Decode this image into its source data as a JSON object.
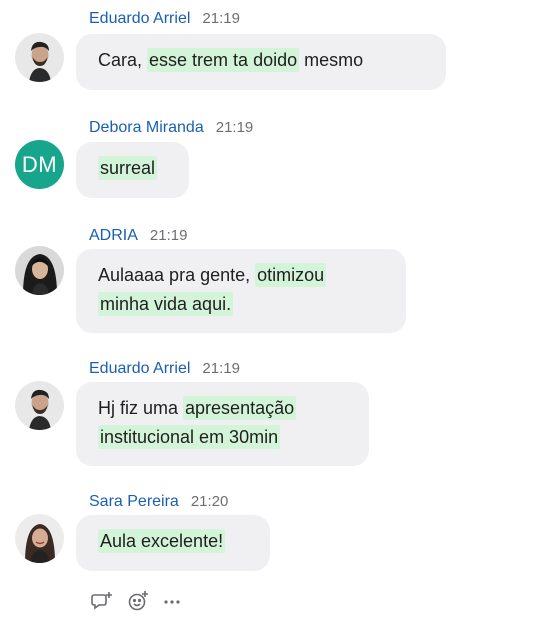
{
  "messages": [
    {
      "author": "Eduardo Arriel",
      "time": "21:19",
      "avatar": "photo-man-beard",
      "lines": [
        [
          {
            "t": "Cara, "
          },
          {
            "t": "esse trem ta doido",
            "hl": true
          },
          {
            "t": " mesmo"
          }
        ]
      ]
    },
    {
      "author": "Debora Miranda",
      "time": "21:19",
      "avatar": "initials",
      "initials": "DM",
      "lines": [
        [
          {
            "t": "surreal",
            "hl": true
          }
        ]
      ]
    },
    {
      "author": "ADRIA",
      "time": "21:19",
      "avatar": "photo-woman-dark-hair",
      "lines": [
        [
          {
            "t": "Aulaaaa pra gente, "
          },
          {
            "t": "otimizou",
            "hl": true
          }
        ],
        [
          {
            "t": "minha vida aqui.",
            "hl": true
          }
        ]
      ]
    },
    {
      "author": "Eduardo Arriel",
      "time": "21:19",
      "avatar": "photo-man-beard",
      "lines": [
        [
          {
            "t": "Hj fiz uma "
          },
          {
            "t": "apresentação",
            "hl": true
          }
        ],
        [
          {
            "t": "institucional em 30min",
            "hl": true
          }
        ]
      ]
    },
    {
      "author": "Sara Pereira",
      "time": "21:20",
      "avatar": "photo-woman-smiling",
      "lines": [
        [
          {
            "t": "Aula excelente!",
            "hl": true
          }
        ]
      ]
    }
  ],
  "actions": [
    {
      "icon": "reply-thread-icon"
    },
    {
      "icon": "add-reaction-icon"
    },
    {
      "icon": "more-options-icon"
    }
  ],
  "colors": {
    "author_name": "#1a5fb4",
    "bubble": "#f0f0f3",
    "highlight": "#d3f4d9",
    "initials_avatar": "#17a58c"
  }
}
